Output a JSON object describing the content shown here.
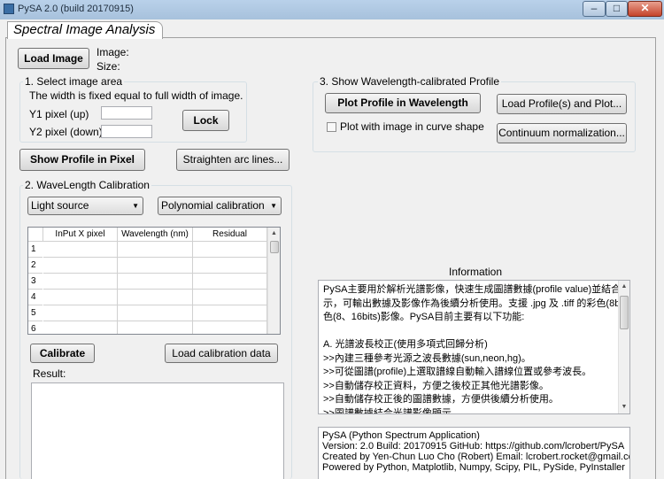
{
  "window": {
    "title": "PySA 2.0  (build 20170915)",
    "minimize": "–",
    "maximize": "□",
    "close": "✕"
  },
  "tab": {
    "label": "Spectral Image Analysis"
  },
  "load": {
    "button": "Load Image",
    "image_label": "Image:",
    "size_label": "Size:"
  },
  "select_area": {
    "title": "1. Select image area",
    "note": "The width is fixed equal to full width of image.",
    "y1_label": "Y1 pixel (up)",
    "y2_label": "Y2 pixel (down)",
    "y1_value": "",
    "y2_value": "",
    "lock_button": "Lock"
  },
  "profile": {
    "show_pixel_button": "Show Profile in Pixel",
    "straighten_button": "Straighten arc lines..."
  },
  "calibration": {
    "title": "2. WaveLength Calibration",
    "light_source": "Light source",
    "method": "Polynomial calibration",
    "columns": [
      "InPut X pixel",
      "Wavelength (nm)",
      "Residual"
    ],
    "rows": [
      "1",
      "2",
      "3",
      "4",
      "5",
      "6"
    ],
    "calibrate_button": "Calibrate",
    "load_data_button": "Load calibration data",
    "result_label": "Result:"
  },
  "show_wavelength": {
    "title": "3. Show Wavelength-calibrated Profile",
    "plot_button": "Plot Profile in Wavelength",
    "load_plot_button": "Load Profile(s) and Plot...",
    "curve_checkbox": "Plot with image in curve shape",
    "curve_checked": false,
    "continuum_button": "Continuum normalization..."
  },
  "information": {
    "title": "Information",
    "lines": [
      "PySA主要用於解析光譜影像，快速生成圖譜數據(profile value)並結合影像顯",
      "示，可輸出數據及影像作為後續分析使用。支援 .jpg 及 .tiff 的彩色(8bits)或單",
      "色(8、16bits)影像。PySA目前主要有以下功能:",
      "",
      "A. 光譜波長校正(使用多項式回歸分析)",
      "    >>內建三種參考光源之波長數據(sun,neon,hg)。",
      "    >>可從圖譜(profile)上選取譜線自動輸入譜線位置或參考波長。",
      "    >>自動儲存校正資料，方便之後校正其他光譜影像。",
      "    >>自動儲存校正後的圖譜數據，方便供後續分析使用。",
      "    >>圖譜數據結合光譜影像顯示。"
    ],
    "about": [
      "PySA (Python Spectrum Application)",
      "Version: 2.0  Build: 20170915  GitHub: https://github.com/lcrobert/PySA",
      "Created by Yen-Chun Luo Cho (Robert)  Email: lcrobert.rocket@gmail.com",
      "Powered by Python, Matplotlib, Numpy, Scipy, PIL, PySide, PyInstaller"
    ]
  }
}
